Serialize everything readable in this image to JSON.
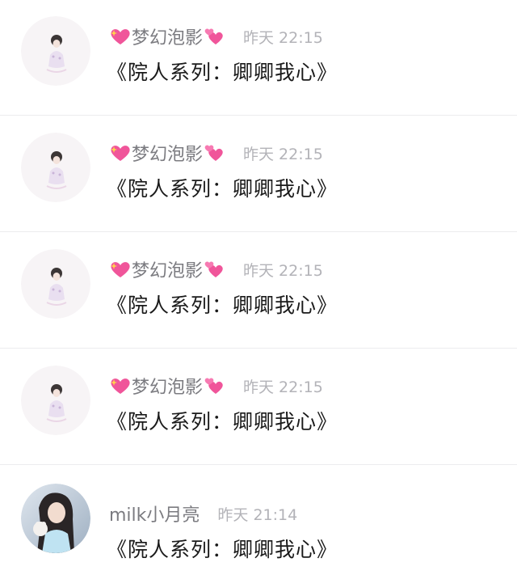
{
  "comments": [
    {
      "username": "梦幻泡影",
      "name_prefix_icon": "sparkling-heart",
      "name_suffix_icon": "two-hearts",
      "time": "昨天 22:15",
      "text": "《院人系列：卿卿我心》",
      "avatar": "anime-girl-avatar"
    },
    {
      "username": "梦幻泡影",
      "name_prefix_icon": "sparkling-heart",
      "name_suffix_icon": "two-hearts",
      "time": "昨天 22:15",
      "text": "《院人系列：卿卿我心》",
      "avatar": "anime-girl-avatar"
    },
    {
      "username": "梦幻泡影",
      "name_prefix_icon": "sparkling-heart",
      "name_suffix_icon": "two-hearts",
      "time": "昨天 22:15",
      "text": "《院人系列：卿卿我心》",
      "avatar": "anime-girl-avatar"
    },
    {
      "username": "梦幻泡影",
      "name_prefix_icon": "sparkling-heart",
      "name_suffix_icon": "two-hearts",
      "time": "昨天 22:15",
      "text": "《院人系列：卿卿我心》",
      "avatar": "anime-girl-avatar"
    },
    {
      "username": "milk小月亮",
      "time": "昨天 21:14",
      "text": "《院人系列：卿卿我心》",
      "avatar": "photo-girl-avatar"
    }
  ],
  "colors": {
    "username": "#7b7b80",
    "time": "#b3b3b8",
    "text": "#1a1a1a",
    "divider": "#ececee",
    "heart": "#f0559a"
  }
}
